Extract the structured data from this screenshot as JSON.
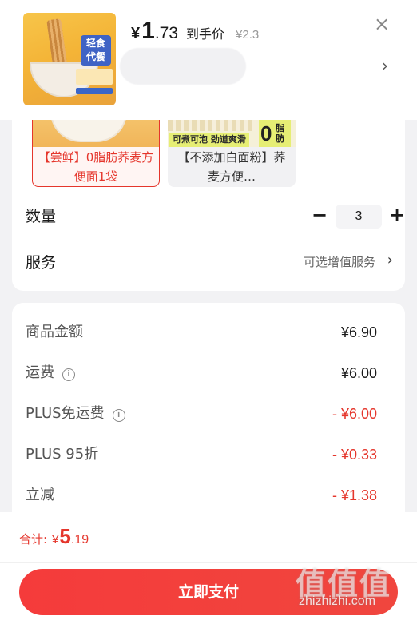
{
  "product": {
    "thumbnail_badge": "轻食\n代餐",
    "currency": "¥",
    "price_int": "1",
    "price_dec": ".73",
    "price_tag": "到手价",
    "original_price": "¥2.3"
  },
  "options": [
    {
      "label": "【尝鲜】0脂肪荞麦方便面1袋",
      "selected": true
    },
    {
      "label": "【不添加白面粉】荞麦方便…",
      "selected": false,
      "image_slogan": "可煮可泡 劲道爽滑",
      "image_zero": "0",
      "image_zero_text": "脂肪"
    }
  ],
  "quantity": {
    "label": "数量",
    "minus": "−",
    "value": "3",
    "plus": "+"
  },
  "service": {
    "label": "服务",
    "value": "可选增值服务",
    "chevron": "›"
  },
  "fees": [
    {
      "label": "商品金额",
      "value": "¥6.90",
      "info": false,
      "negative": false
    },
    {
      "label": "运费",
      "value": "¥6.00",
      "info": true,
      "negative": false
    },
    {
      "label": "PLUS免运费",
      "value": "- ¥6.00",
      "info": true,
      "negative": true
    },
    {
      "label": "PLUS 95折",
      "value": "- ¥0.33",
      "info": false,
      "negative": true
    },
    {
      "label": "立减",
      "value": "- ¥1.38",
      "info": false,
      "negative": true
    }
  ],
  "total": {
    "label": "合计:",
    "yen": "¥",
    "int": "5",
    "dec": ".19"
  },
  "pay_button": "立即支付",
  "close_icon": "×",
  "header_chevron": "›",
  "watermark": {
    "logo": "值值值",
    "text": "zhizhizhi.com"
  },
  "colors": {
    "accent": "#e5362c",
    "pay_button": "#f53b3b",
    "background": "#f2f2f4"
  }
}
